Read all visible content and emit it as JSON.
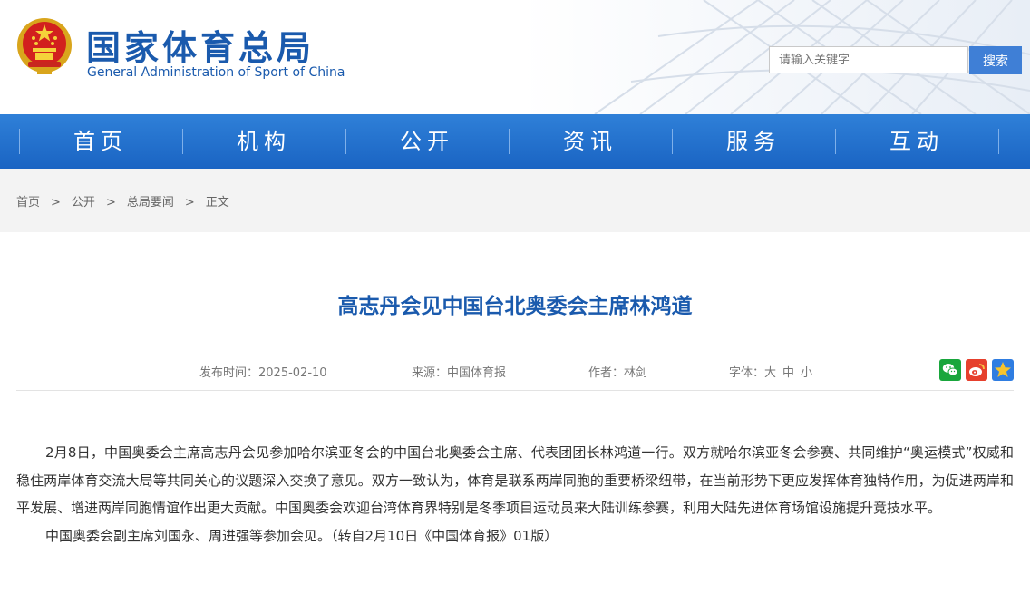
{
  "header": {
    "title_cn": "国家体育总局",
    "title_en": "General Administration of Sport of China",
    "search_placeholder": "请输入关键字",
    "search_button": "搜索"
  },
  "nav": {
    "items": [
      {
        "label": "首页"
      },
      {
        "label": "机构"
      },
      {
        "label": "公开"
      },
      {
        "label": "资讯"
      },
      {
        "label": "服务"
      },
      {
        "label": "互动"
      }
    ]
  },
  "breadcrumb": {
    "items": [
      "首页",
      "公开",
      "总局要闻",
      "正文"
    ],
    "separator": ">"
  },
  "article": {
    "title": "高志丹会见中国台北奥委会主席林鸿道",
    "date": "发布时间：2025-02-10",
    "source": "来源：中国体育报",
    "author": "作者：林剑",
    "font_size_label": "字体：",
    "font_large": "大",
    "font_medium": "中",
    "font_small": "小",
    "paragraphs": [
      "2月8日，中国奥委会主席高志丹会见参加哈尔滨亚冬会的中国台北奥委会主席、代表团团长林鸿道一行。双方就哈尔滨亚冬会参赛、共同维护“奥运模式”权威和稳住两岸体育交流大局等共同关心的议题深入交换了意见。双方一致认为，体育是联系两岸同胞的重要桥梁纽带，在当前形势下更应发挥体育独特作用，为促进两岸和平发展、增进两岸同胞情谊作出更大贡献。中国奥委会欢迎台湾体育界特别是冬季项目运动员来大陆训练参赛，利用大陆先进体育场馆设施提升竞技水平。",
      "中国奥委会副主席刘国永、周进强等参加会见。（转自2月10日《中国体育报》01版）"
    ]
  },
  "colors": {
    "brand_blue": "#1a5aad",
    "nav_blue": "#1f6ccb",
    "search_blue": "#3f7fd6",
    "wechat_green": "#19a63c",
    "weibo_red": "#e6402d",
    "favorite_blue": "#2f7de1"
  },
  "icons": [
    "national-emblem-icon",
    "wechat-share-icon",
    "weibo-share-icon",
    "favorite-star-icon"
  ]
}
